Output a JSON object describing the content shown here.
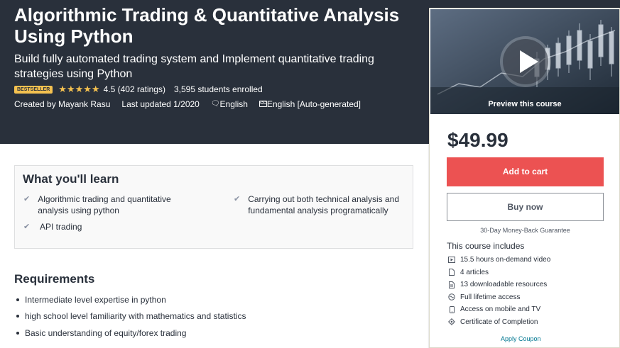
{
  "course": {
    "title": "Algorithmic Trading & Quantitative Analysis Using Python",
    "subtitle": "Build fully automated trading system and Implement quantitative trading strategies using Python",
    "badge": "BESTSELLER",
    "stars_icon": "★★★★★",
    "rating": "4.5 (402 ratings)",
    "students": "3,595 students enrolled",
    "created_by": "Created by Mayank Rasu",
    "last_updated": "Last updated 1/2020",
    "language": "English",
    "captions": "English [Auto-generated]",
    "captions_icon_label": "CC"
  },
  "sidebar": {
    "preview_label": "Preview this course",
    "price": "$49.99",
    "add_to_cart": "Add to cart",
    "buy_now": "Buy now",
    "guarantee": "30-Day Money-Back Guarantee",
    "includes_title": "This course includes",
    "includes": [
      {
        "icon": "video-icon",
        "text": "15.5 hours on-demand video"
      },
      {
        "icon": "file-icon",
        "text": "4 articles"
      },
      {
        "icon": "download-icon",
        "text": "13 downloadable resources"
      },
      {
        "icon": "infinity-icon",
        "text": "Full lifetime access"
      },
      {
        "icon": "mobile-icon",
        "text": "Access on mobile and TV"
      },
      {
        "icon": "certificate-icon",
        "text": "Certificate of Completion"
      }
    ],
    "apply_coupon_peek": "Apply Coupon"
  },
  "learn": {
    "title": "What you'll learn",
    "items": [
      "Algorithmic trading and quantitative analysis using python",
      "Carrying out both technical analysis and fundamental analysis programatically",
      "API trading"
    ]
  },
  "requirements": {
    "title": "Requirements",
    "items": [
      "Intermediate level expertise in python",
      "high school level familiarity with mathematics and statistics",
      "Basic understanding of equity/forex trading"
    ]
  },
  "colors": {
    "hero_bg": "#29303b",
    "accent_red": "#ec5252",
    "badge_yellow": "#f4c150"
  }
}
